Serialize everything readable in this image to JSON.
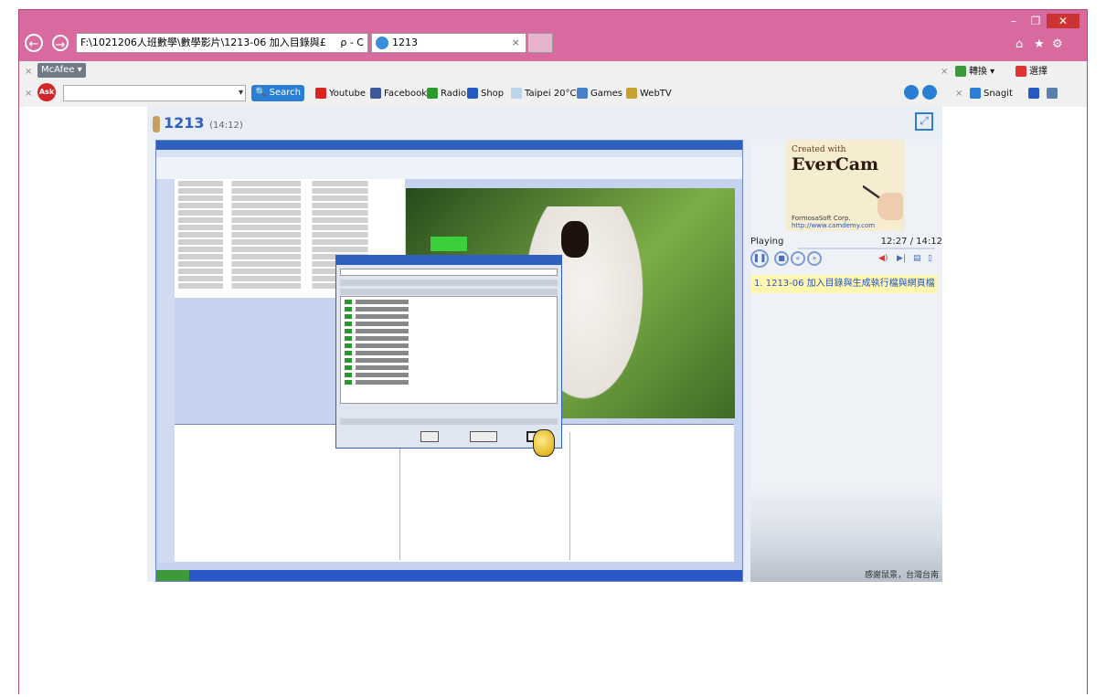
{
  "browser": {
    "address": "F:\\1021206人班數學\\數學影片\\1213-06 加入目錄與£",
    "address_controls": "ρ - C",
    "tab_title": "1213",
    "tab_close": "×",
    "window_controls": [
      "–",
      "❐",
      "✕"
    ],
    "right_icons": [
      "⌂",
      "★",
      "⚙"
    ]
  },
  "toolbar1": {
    "x": "×",
    "mcafee_label": "McAfee",
    "right_items": [
      "×",
      "轉換",
      "選擇"
    ]
  },
  "toolbar2": {
    "x": "×",
    "ask_label": "Ask",
    "search_button": "Search",
    "links": [
      "Youtube",
      "Facebook",
      "Radio",
      "Shop",
      "Taipei 20°C",
      "Games",
      "WebTV"
    ],
    "right_x": "×",
    "snagit": "Snagit"
  },
  "player": {
    "title": "1213",
    "duration": "(14:12)"
  },
  "ad": {
    "created_with": "Created with",
    "brand": "EverCam",
    "company": "FormosaSoft Corp.",
    "url": "http://www.camdemy.com"
  },
  "side": {
    "status": "Playing",
    "time": "12:27 / 14:12",
    "playlist_item": "1. 1213-06 加入目錄與生成執行檔與網頁檔",
    "caption": "感謝鼠景，台灣台南"
  },
  "colors": {
    "browser_frame": "#d96aa0",
    "accent_blue": "#2f5fbf",
    "highlight_yellow": "#fff7b0"
  }
}
